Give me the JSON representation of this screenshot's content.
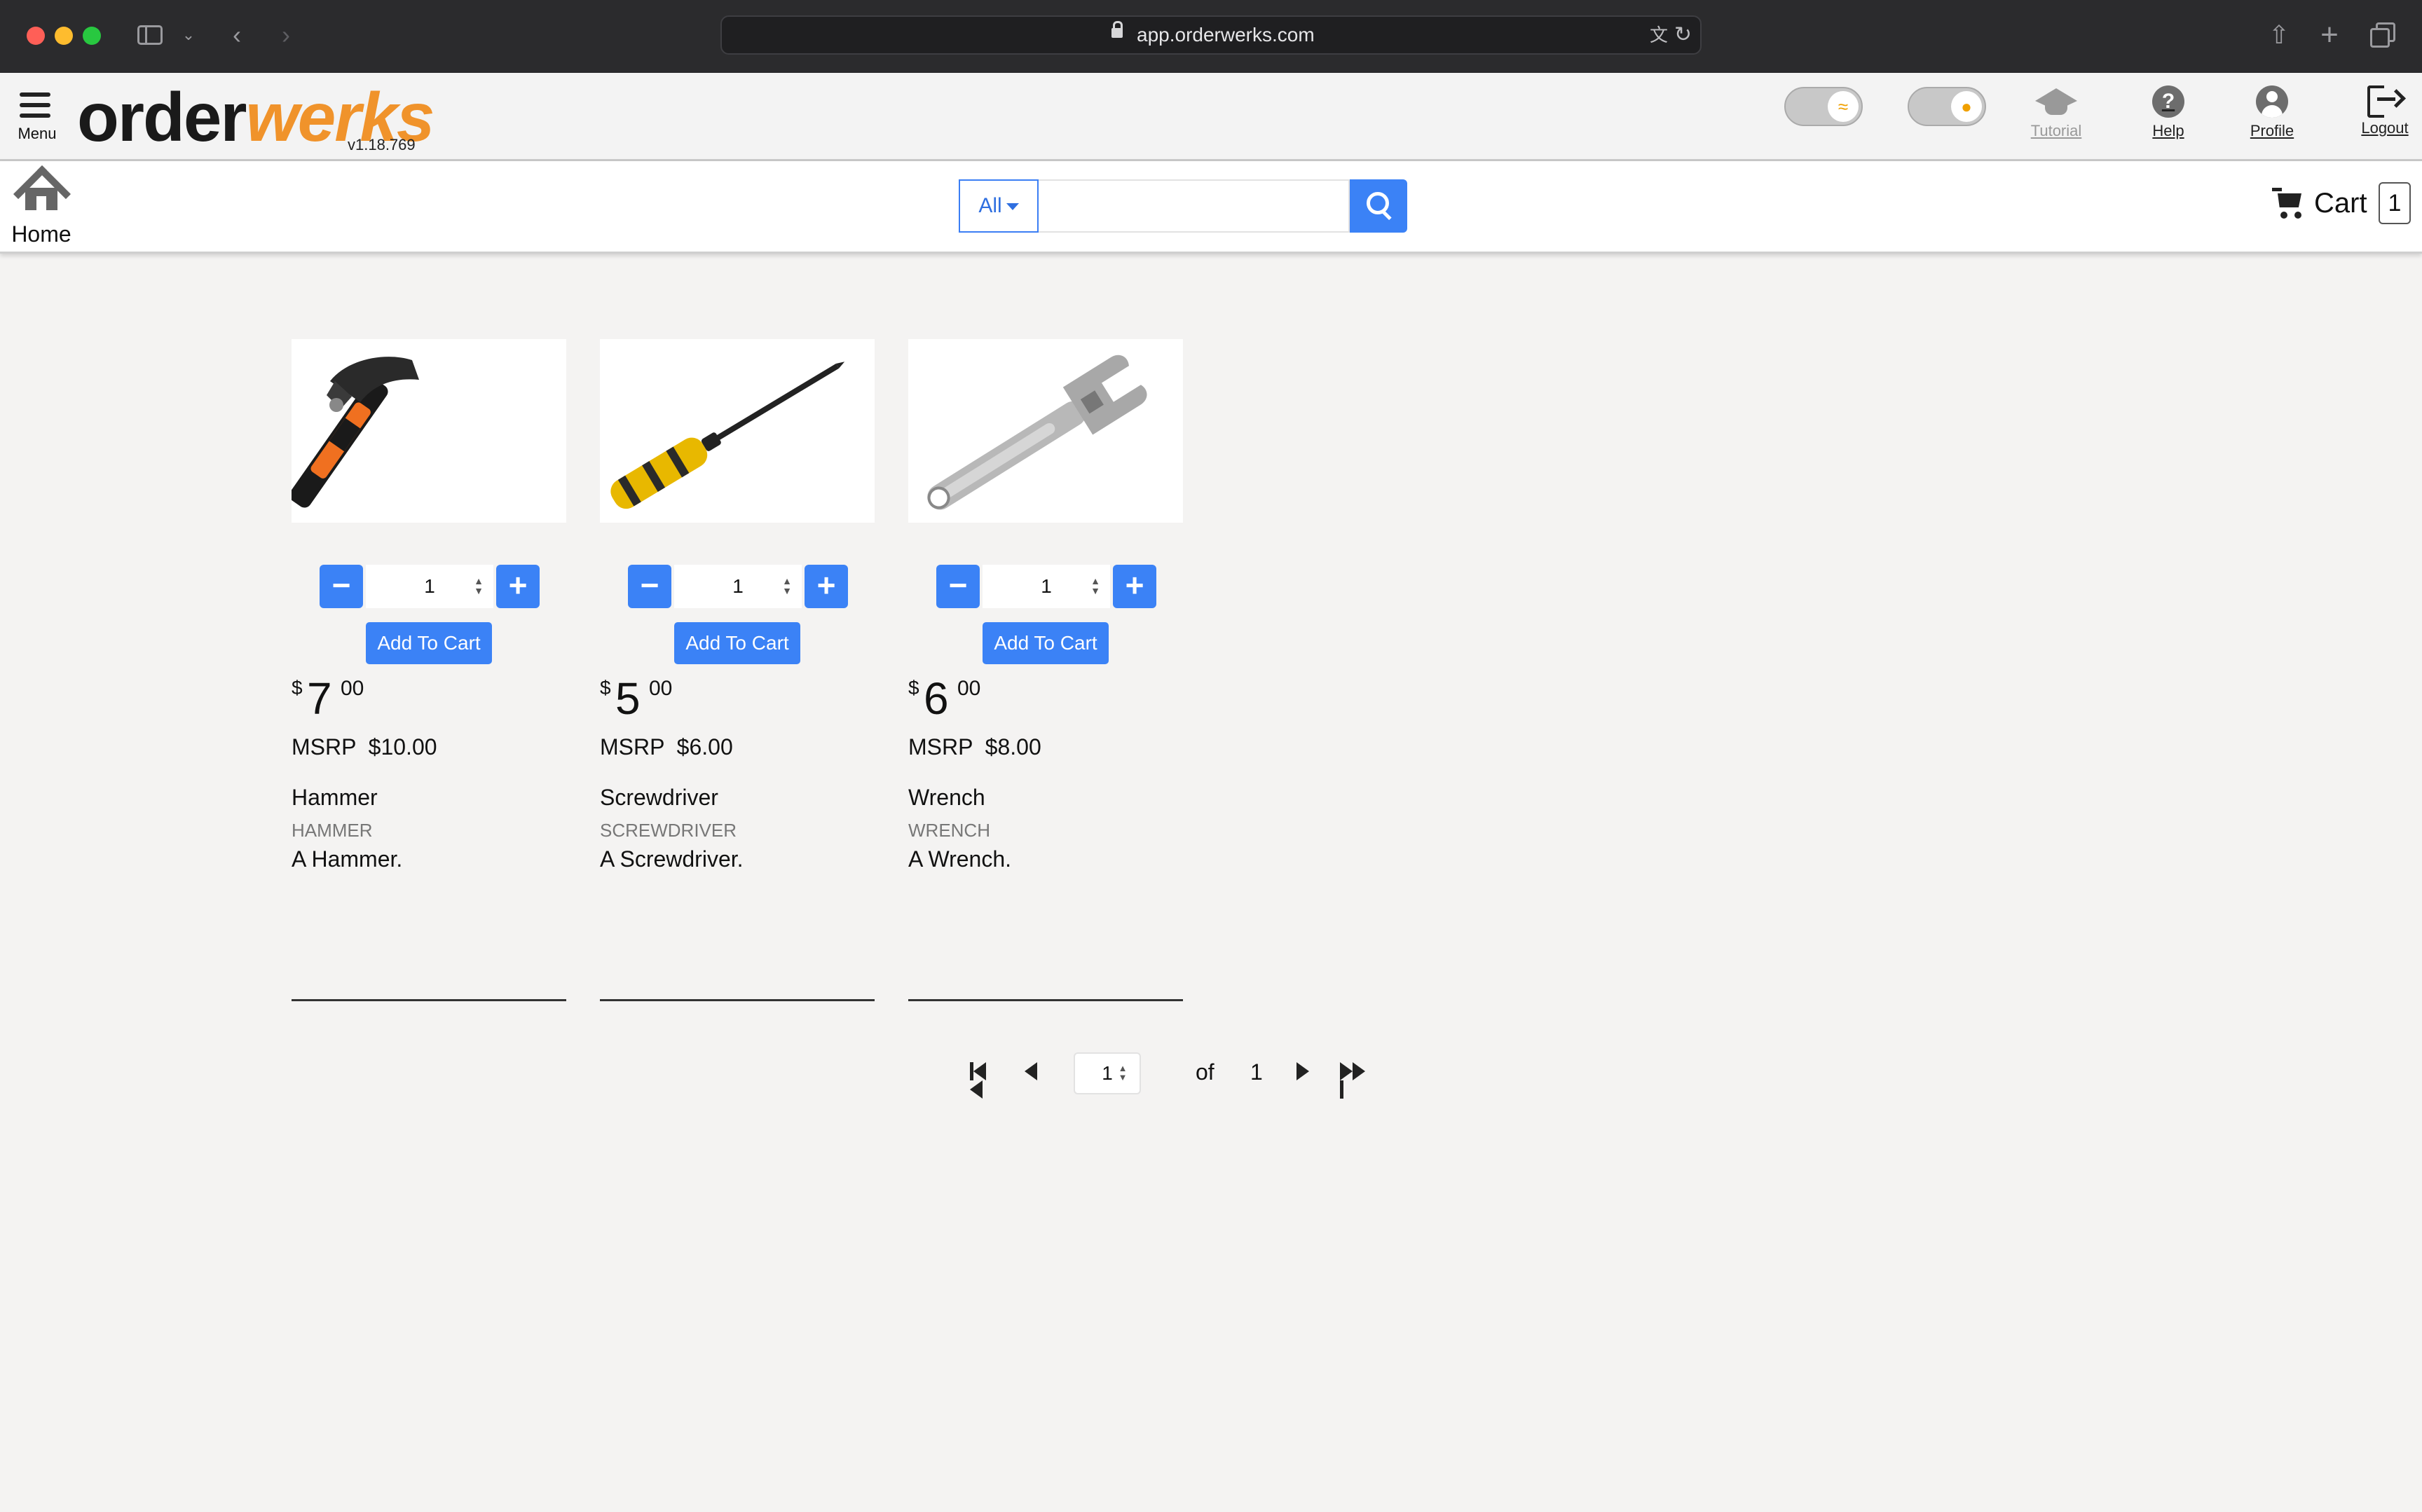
{
  "browser": {
    "url": "app.orderwerks.com"
  },
  "header": {
    "menu_label": "Menu",
    "logo_dark": "order",
    "logo_accent": "werks",
    "version": "v1.18.769",
    "links": {
      "tutorial": "Tutorial",
      "help": "Help",
      "profile": "Profile",
      "logout": "Logout"
    }
  },
  "subbar": {
    "home_label": "Home",
    "category": "All",
    "search_value": "",
    "cart_label": "Cart",
    "cart_count": "1"
  },
  "products": [
    {
      "name": "Hammer",
      "sku": "HAMMER",
      "description": "A Hammer.",
      "qty": "1",
      "add_label": "Add To Cart",
      "currency": "$",
      "price_whole": "7",
      "price_cents": "00",
      "msrp_label": "MSRP",
      "msrp": "$10.00"
    },
    {
      "name": "Screwdriver",
      "sku": "SCREWDRIVER",
      "description": "A Screwdriver.",
      "qty": "1",
      "add_label": "Add To Cart",
      "currency": "$",
      "price_whole": "5",
      "price_cents": "00",
      "msrp_label": "MSRP",
      "msrp": "$6.00"
    },
    {
      "name": "Wrench",
      "sku": "WRENCH",
      "description": "A Wrench.",
      "qty": "1",
      "add_label": "Add To Cart",
      "currency": "$",
      "price_whole": "6",
      "price_cents": "00",
      "msrp_label": "MSRP",
      "msrp": "$8.00"
    }
  ],
  "pagination": {
    "current": "1",
    "of_label": "of",
    "total": "1"
  },
  "colors": {
    "accent": "#3b82f6",
    "logo_orange": "#f0932b",
    "background": "#f4f3f2"
  }
}
